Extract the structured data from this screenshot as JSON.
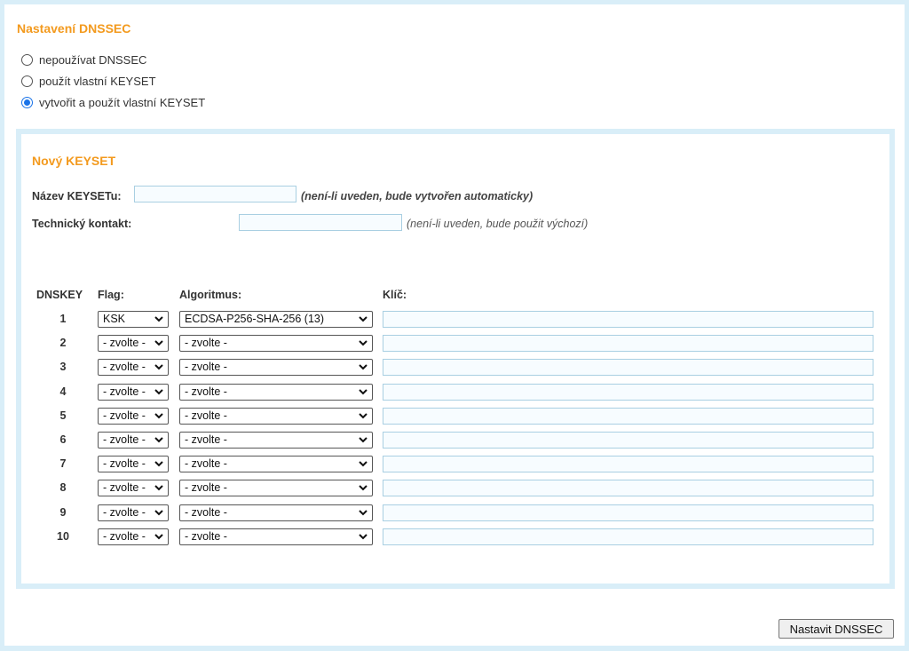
{
  "dnssec": {
    "title": "Nastavení DNSSEC",
    "options": [
      {
        "label": "nepoužívat DNSSEC",
        "checked": false
      },
      {
        "label": "použít vlastní KEYSET",
        "checked": false
      },
      {
        "label": "vytvořit a použít vlastní KEYSET",
        "checked": true
      }
    ]
  },
  "keyset": {
    "title": "Nový KEYSET",
    "name_label": "Název KEYSETu:",
    "name_value": "",
    "name_hint": "(není-li uveden, bude vytvořen automaticky)",
    "contact_label": "Technický kontakt:",
    "contact_value": "",
    "contact_hint": "(není-li uveden, bude použit výchozí)",
    "columns": {
      "dnskey": "DNSKEY",
      "flag": "Flag:",
      "algorithm": "Algoritmus:",
      "key": "Klíč:"
    },
    "rows": [
      {
        "num": "1",
        "flag": "KSK",
        "algorithm": "ECDSA-P256-SHA-256 (13)",
        "key": ""
      },
      {
        "num": "2",
        "flag": "- zvolte -",
        "algorithm": "- zvolte -",
        "key": ""
      },
      {
        "num": "3",
        "flag": "- zvolte -",
        "algorithm": "- zvolte -",
        "key": ""
      },
      {
        "num": "4",
        "flag": "- zvolte -",
        "algorithm": "- zvolte -",
        "key": ""
      },
      {
        "num": "5",
        "flag": "- zvolte -",
        "algorithm": "- zvolte -",
        "key": ""
      },
      {
        "num": "6",
        "flag": "- zvolte -",
        "algorithm": "- zvolte -",
        "key": ""
      },
      {
        "num": "7",
        "flag": "- zvolte -",
        "algorithm": "- zvolte -",
        "key": ""
      },
      {
        "num": "8",
        "flag": "- zvolte -",
        "algorithm": "- zvolte -",
        "key": ""
      },
      {
        "num": "9",
        "flag": "- zvolte -",
        "algorithm": "- zvolte -",
        "key": ""
      },
      {
        "num": "10",
        "flag": "- zvolte -",
        "algorithm": "- zvolte -",
        "key": ""
      }
    ]
  },
  "submit_label": "Nastavit DNSSEC",
  "colors": {
    "accent": "#f39a1e",
    "border": "#d9eef8",
    "radio_checked": "#1a73e8"
  }
}
